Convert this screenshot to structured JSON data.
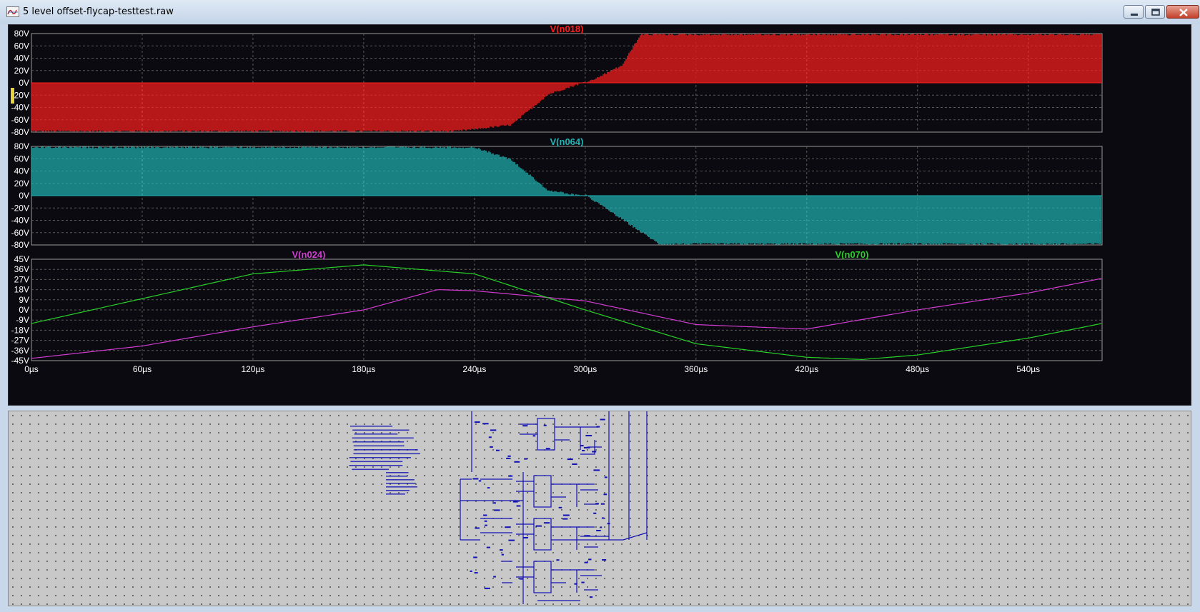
{
  "window": {
    "title": "5 level offset-flycap-testtest.raw"
  },
  "colors": {
    "n018": "#ff1e1e",
    "n064": "#20b4b4",
    "n024": "#d23cd2",
    "n070": "#28d228",
    "grid": "#5a5a5a",
    "bg": "#0a0a10"
  },
  "chart_data": [
    {
      "type": "line",
      "title": "V(n018)",
      "x_ticks": [
        "0µs",
        "60µs",
        "120µs",
        "180µs",
        "240µs",
        "300µs",
        "360µs",
        "420µs",
        "480µs",
        "540µs"
      ],
      "y_ticks": [
        "80V",
        "60V",
        "40V",
        "20V",
        "0V",
        "-20V",
        "-40V",
        "-60V",
        "-80V"
      ],
      "xlim": [
        0,
        580
      ],
      "ylim": [
        -80,
        80
      ],
      "series": [
        {
          "name": "V(n018)",
          "description_points": {
            "x": [
              0,
              230,
              260,
              280,
              300,
              320,
              330,
              580
            ],
            "y_envelope_min": [
              -80,
              -80,
              -70,
              -20,
              0,
              0,
              0,
              0
            ],
            "y_envelope_max": [
              0,
              0,
              0,
              0,
              0,
              30,
              80,
              80
            ]
          }
        }
      ]
    },
    {
      "type": "line",
      "title": "V(n064)",
      "x_ticks": [
        "0µs",
        "60µs",
        "120µs",
        "180µs",
        "240µs",
        "300µs",
        "360µs",
        "420µs",
        "480µs",
        "540µs"
      ],
      "y_ticks": [
        "80V",
        "60V",
        "40V",
        "20V",
        "0V",
        "-20V",
        "-40V",
        "-60V",
        "-80V"
      ],
      "xlim": [
        0,
        580
      ],
      "ylim": [
        -80,
        80
      ],
      "series": [
        {
          "name": "V(n064)",
          "description_points": {
            "x": [
              0,
              240,
              260,
              280,
              300,
              320,
              340,
              580
            ],
            "y_envelope_min": [
              0,
              0,
              0,
              0,
              0,
              -40,
              -80,
              -80
            ],
            "y_envelope_max": [
              80,
              80,
              60,
              10,
              0,
              0,
              0,
              0
            ]
          }
        }
      ]
    },
    {
      "type": "line",
      "x_ticks": [
        "0µs",
        "60µs",
        "120µs",
        "180µs",
        "240µs",
        "300µs",
        "360µs",
        "420µs",
        "480µs",
        "540µs"
      ],
      "y_ticks": [
        "45V",
        "36V",
        "27V",
        "18V",
        "9V",
        "0V",
        "-9V",
        "-18V",
        "-27V",
        "-36V",
        "-45V"
      ],
      "xlim": [
        0,
        580
      ],
      "ylim": [
        -45,
        45
      ],
      "series": [
        {
          "name": "V(n024)",
          "x": [
            0,
            60,
            120,
            180,
            220,
            240,
            300,
            360,
            420,
            480,
            540,
            580
          ],
          "y": [
            -43,
            -32,
            -15,
            0,
            18,
            17,
            8,
            -13,
            -17,
            0,
            15,
            28
          ]
        },
        {
          "name": "V(n070)",
          "x": [
            0,
            60,
            120,
            180,
            240,
            300,
            360,
            420,
            450,
            480,
            540,
            580
          ],
          "y": [
            -12,
            10,
            32,
            40,
            32,
            0,
            -30,
            -42,
            -44,
            -40,
            -25,
            -12
          ]
        }
      ]
    }
  ]
}
